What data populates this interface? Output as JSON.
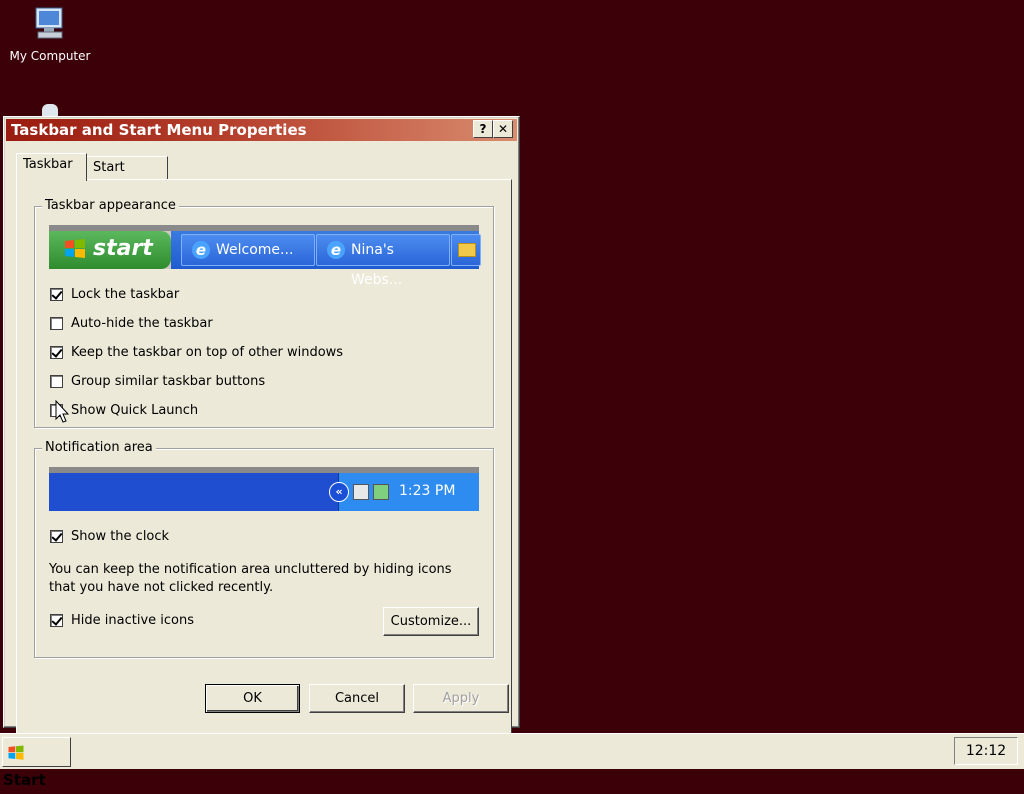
{
  "desktop": {
    "icons": [
      {
        "label": "My Computer",
        "icon": "my-computer-icon"
      }
    ]
  },
  "dialog": {
    "title": "Taskbar and Start Menu Properties",
    "help_button": "?",
    "close_button": "✕",
    "tabs": [
      "Taskbar",
      "Start Menu"
    ],
    "active_tab": "Taskbar",
    "taskbar_appearance": {
      "group_title": "Taskbar appearance",
      "preview": {
        "start_label": "start",
        "buttons": [
          "Welcome...",
          "Nina's Webs..."
        ]
      },
      "options": [
        {
          "label": "Lock the taskbar",
          "checked": true
        },
        {
          "label": "Auto-hide the taskbar",
          "checked": false
        },
        {
          "label": "Keep the taskbar on top of other windows",
          "checked": true
        },
        {
          "label": "Group similar taskbar buttons",
          "checked": false
        },
        {
          "label": "Show Quick Launch",
          "checked": false
        }
      ]
    },
    "notification_area": {
      "group_title": "Notification area",
      "preview_time": "1:23 PM",
      "show_clock": {
        "label": "Show the clock",
        "checked": true
      },
      "description": "You can keep the notification area uncluttered by hiding icons that you have not clicked recently.",
      "hide_inactive": {
        "label": "Hide inactive icons",
        "checked": true
      },
      "customize_label": "Customize..."
    },
    "buttons": {
      "ok": "OK",
      "cancel": "Cancel",
      "apply": "Apply"
    }
  },
  "taskbar": {
    "start_label": "Start",
    "clock": "12:12"
  },
  "colors": {
    "desktop": "#3b0008",
    "title_gradient_start": "#9a1b0f",
    "dialog_face": "#ece9d8"
  }
}
